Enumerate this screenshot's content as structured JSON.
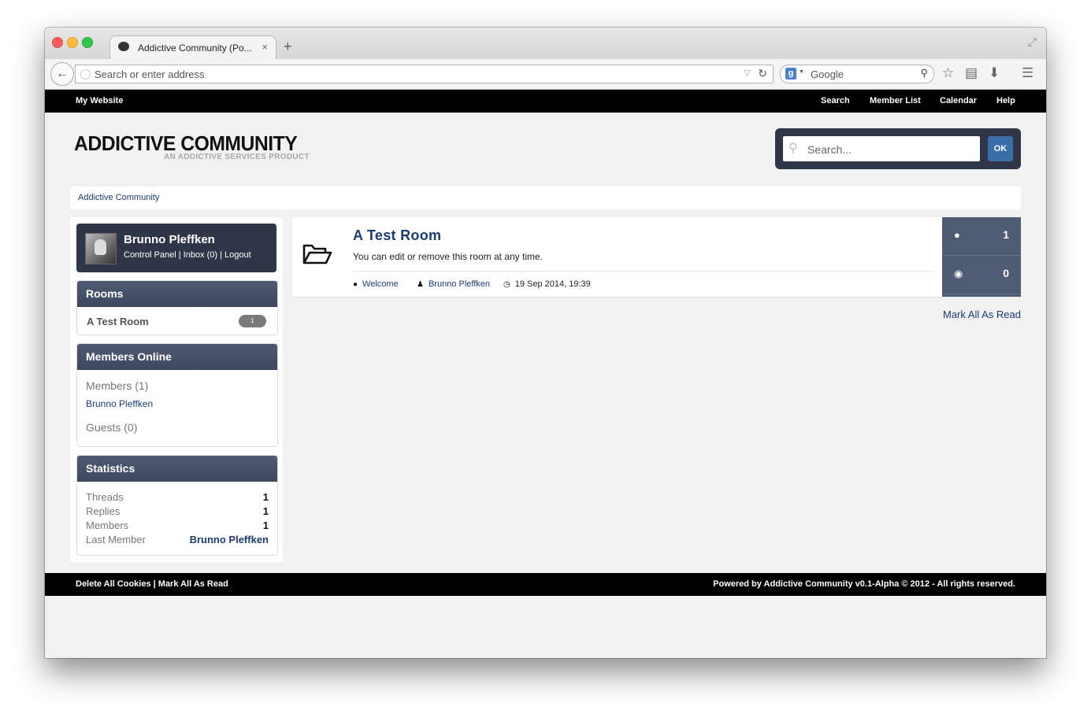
{
  "browser": {
    "tab_title": "Addictive Community (Po...",
    "url_placeholder": "Search or enter address",
    "search_engine_placeholder": "Google"
  },
  "nav": {
    "site_link": "My Website",
    "links": [
      "Search",
      "Member List",
      "Calendar",
      "Help"
    ]
  },
  "header": {
    "title": "ADDICTIVE COMMUNITY",
    "subtitle": "AN ADDICTIVE SERVICES PRODUCT",
    "search_placeholder": "Search...",
    "search_button": "OK"
  },
  "breadcrumb": "Addictive Community",
  "user": {
    "name": "Brunno Pleffken",
    "control_panel": "Control Panel",
    "inbox": "Inbox (0)",
    "logout": "Logout"
  },
  "rooms_panel": {
    "title": "Rooms",
    "items": [
      {
        "name": "A Test Room",
        "count": "1"
      }
    ]
  },
  "members_online": {
    "title": "Members Online",
    "members_label": "Members (1)",
    "members": [
      "Brunno Pleffken"
    ],
    "guests_label": "Guests (0)"
  },
  "statistics": {
    "title": "Statistics",
    "rows": [
      {
        "label": "Threads",
        "value": "1"
      },
      {
        "label": "Replies",
        "value": "1"
      },
      {
        "label": "Members",
        "value": "1"
      },
      {
        "label": "Last Member",
        "value": "Brunno Pleffken"
      }
    ]
  },
  "room": {
    "title": "A Test Room",
    "description": "You can edit or remove this room at any time.",
    "last_thread": "Welcome",
    "last_author": "Brunno Pleffken",
    "last_date": "19 Sep 2014, 19:39",
    "threads": "1",
    "views": "0"
  },
  "mark_all_read": "Mark All As Read",
  "footer": {
    "delete_cookies": "Delete All Cookies",
    "mark_all_read": "Mark All As Read",
    "powered_by": "Powered by Addictive Community v0.1-Alpha © 2012 - All rights reserved."
  }
}
